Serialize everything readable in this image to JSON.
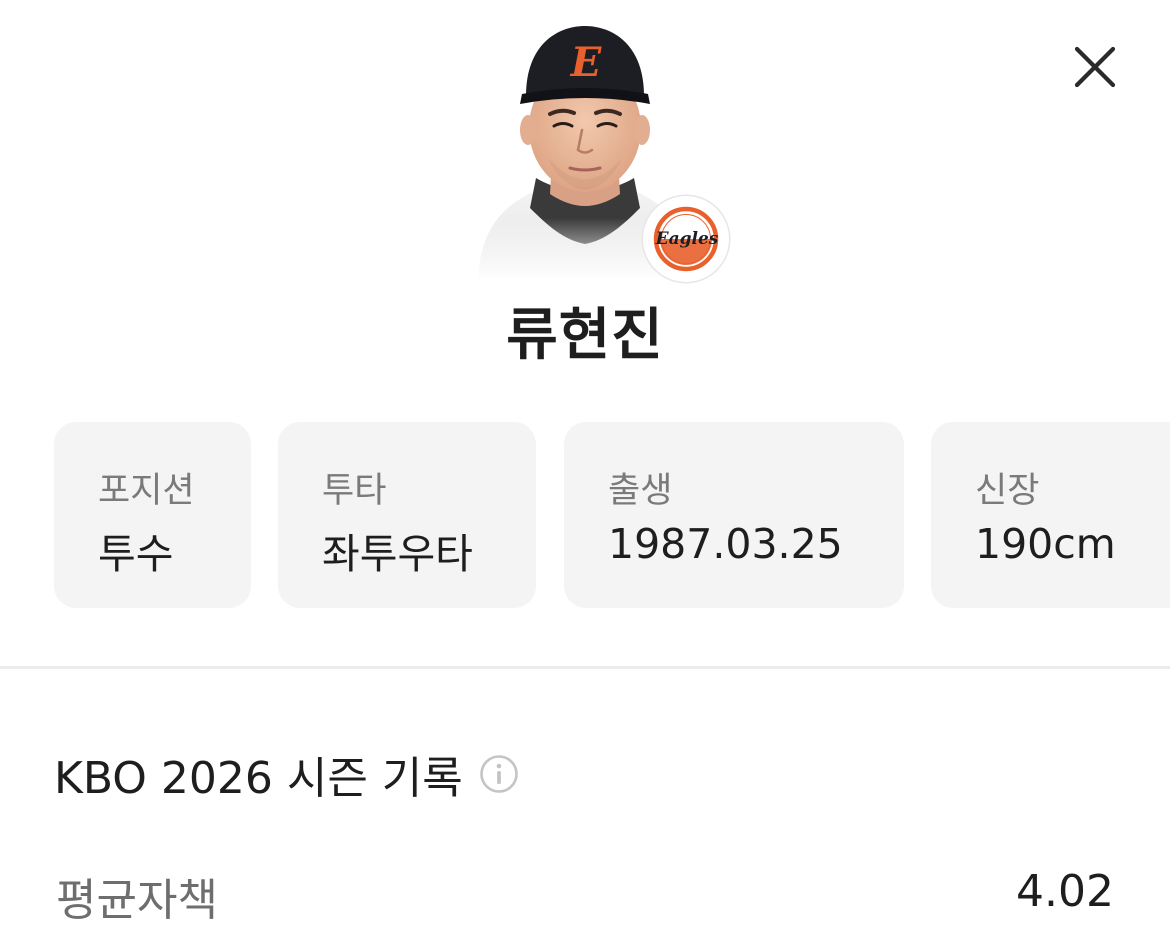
{
  "header": {
    "close_icon": "close-icon"
  },
  "player": {
    "name": "류현진",
    "photo_icon": "player-photo",
    "team_logo_icon": "eagles-logo",
    "cap_letter": "E",
    "team_logo_text": "Eagles",
    "colors": {
      "team_orange": "#e8612c",
      "cap_navy": "#1d1d24"
    }
  },
  "info_cards": [
    {
      "label": "포지션",
      "value": "투수"
    },
    {
      "label": "투타",
      "value": "좌투우타"
    },
    {
      "label": "출생",
      "value": "1987.03.25"
    },
    {
      "label": "신장",
      "value": "190cm"
    }
  ],
  "season": {
    "title": "KBO 2026 시즌 기록",
    "info_icon": "info-icon",
    "stats": [
      {
        "label": "평균자책",
        "value": "4.02"
      }
    ]
  }
}
